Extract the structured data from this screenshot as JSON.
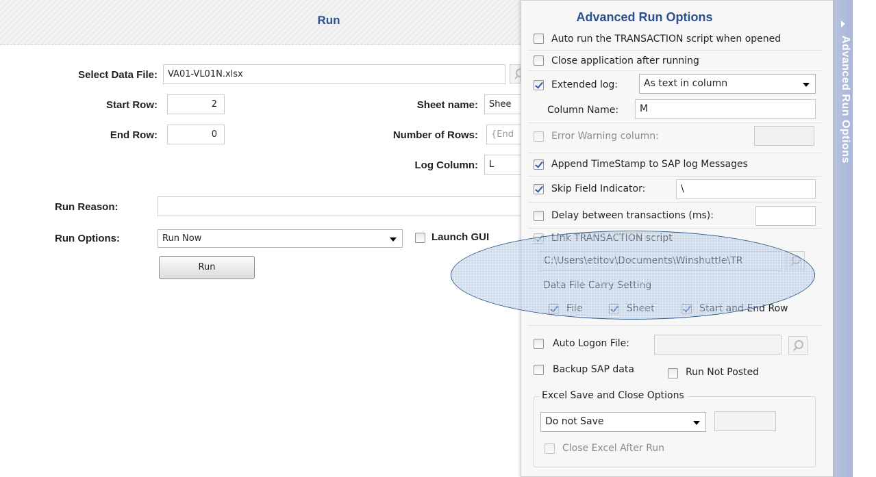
{
  "run_pane": {
    "title": "Run",
    "select_data_file_label": "Select Data File:",
    "data_file_value": "VA01-VL01N.xlsx",
    "start_row_label": "Start Row:",
    "start_row_value": "2",
    "end_row_label": "End Row:",
    "end_row_value": "0",
    "sheet_name_label": "Sheet name:",
    "sheet_name_value": "Shee",
    "number_of_rows_label": "Number of Rows:",
    "number_of_rows_value": "{End",
    "log_column_label": "Log Column:",
    "log_column_value": "L",
    "run_reason_label": "Run Reason:",
    "run_reason_value": "",
    "run_options_label": "Run Options:",
    "run_options_selected": "Run Now",
    "launch_gui_label": "Launch GUI",
    "launch_gui_checked": false,
    "run_button_label": "Run"
  },
  "advanced": {
    "title": "Advanced Run Options",
    "side_tab_label": "Advanced Run Options",
    "auto_run_label": "Auto run the TRANSACTION script when opened",
    "auto_run_checked": false,
    "close_app_label": "Close application after running",
    "close_app_checked": false,
    "extended_log_label": "Extended log:",
    "extended_log_checked": true,
    "extended_log_selected": "As text in column",
    "column_name_label": "Column Name:",
    "column_name_value": "M",
    "error_warning_label": "Error Warning column:",
    "error_warning_checked": false,
    "error_warning_value": "",
    "append_timestamp_label": "Append TimeStamp to SAP log Messages",
    "append_timestamp_checked": true,
    "skip_field_label": "Skip Field Indicator:",
    "skip_field_checked": true,
    "skip_field_value": "\\",
    "delay_label": "Delay between transactions (ms):",
    "delay_checked": false,
    "delay_value": "",
    "link_transaction_label": "Link TRANSACTION script",
    "link_transaction_checked": true,
    "link_path_value": "C:\\Users\\etitov\\Documents\\Winshuttle\\TR",
    "carry_setting_label": "Data File Carry Setting",
    "carry_file_label": "File",
    "carry_file_checked": true,
    "carry_sheet_label": "Sheet",
    "carry_sheet_checked": true,
    "carry_rows_label": "Start and End Row",
    "carry_rows_checked": true,
    "auto_logon_label": "Auto Logon File:",
    "auto_logon_checked": false,
    "auto_logon_value": "",
    "backup_label": "Backup SAP data",
    "backup_checked": false,
    "run_not_posted_label": "Run Not Posted",
    "run_not_posted_checked": false,
    "excel_group_label": "Excel Save and Close Options",
    "excel_save_selected": "Do not Save",
    "excel_extra_value": "",
    "close_excel_label": "Close Excel After Run",
    "close_excel_checked": false
  }
}
